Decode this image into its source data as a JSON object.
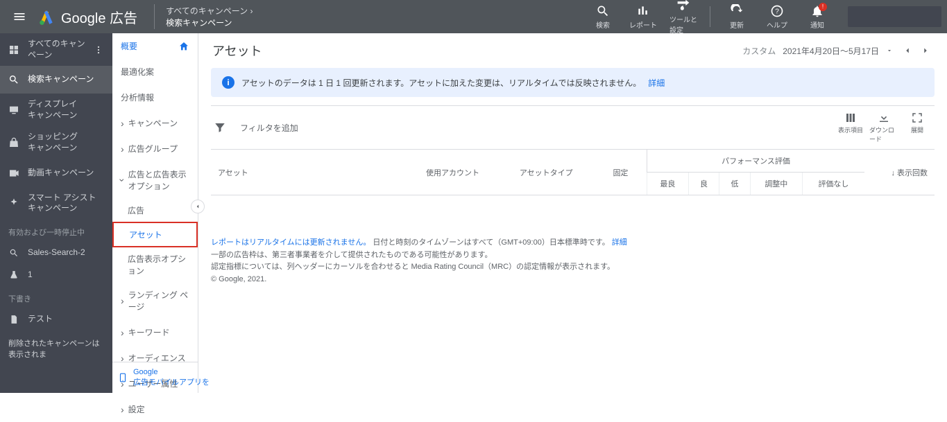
{
  "header": {
    "product": "Google 広告",
    "breadcrumb_top": "すべてのキャンペーン  ›",
    "breadcrumb_bot": "検索キャンペーン",
    "icons": {
      "search": "検索",
      "report": "レポート",
      "tools": "ツールと\n設定",
      "refresh": "更新",
      "help": "ヘルプ",
      "notif": "通知"
    }
  },
  "sidebar_dark": {
    "items": [
      {
        "label": "すべてのキャンペーン",
        "icon": "grid",
        "more": true
      },
      {
        "label": "検索キャンペーン",
        "icon": "search",
        "selected": true
      },
      {
        "label": "ディスプレイ\nキャンペーン",
        "icon": "display"
      },
      {
        "label": "ショッピング\nキャンペーン",
        "icon": "shopping"
      },
      {
        "label": "動画キャンペーン",
        "icon": "video"
      },
      {
        "label": "スマート アシスト\nキャンペーン",
        "icon": "smart"
      }
    ],
    "section1_hdr": "有効および一時停止中",
    "section1_items": [
      {
        "label": "Sales-Search-2",
        "icon": "search"
      },
      {
        "label": "1",
        "icon": "flask"
      }
    ],
    "section2_hdr": "下書き",
    "section2_items": [
      {
        "label": "テスト",
        "icon": "doc"
      }
    ],
    "deleted_note": "削除されたキャンペーンは表示されま"
  },
  "sidebar_light": {
    "overview": "概要",
    "recommend": "最適化案",
    "insights": "分析情報",
    "campaigns": "キャンペーン",
    "adgroups": "広告グループ",
    "ads_ext": "広告と広告表示オプション",
    "sub_ads": "広告",
    "sub_assets": "アセット",
    "sub_ext": "広告表示オプション",
    "landing": "ランディング ページ",
    "keywords": "キーワード",
    "audiences": "オーディエンス",
    "demographics": "ユーザー属性",
    "settings": "設定",
    "footer_app": "Google\n広告モバイルアプリを"
  },
  "main": {
    "title": "アセット",
    "date_custom": "カスタム",
    "date_range": "2021年4月20日～5月17日",
    "banner_text": "アセットのデータは 1 日 1 回更新されます。アセットに加えた変更は、リアルタイムでは反映されません。",
    "banner_link": "詳細",
    "filter_placeholder": "フィルタを追加",
    "tool_columns": "表示項目",
    "tool_download": "ダウンロード",
    "tool_expand": "展開",
    "table": {
      "asset": "アセット",
      "account": "使用アカウント",
      "type": "アセットタイプ",
      "pinned": "固定",
      "perf_group": "パフォーマンス評価",
      "perf_best": "最良",
      "perf_good": "良",
      "perf_low": "低",
      "perf_adjust": "調整中",
      "perf_none": "評価なし",
      "impressions": "表示回数"
    },
    "footer": {
      "l1a": "レポートはリアルタイムには更新されません。",
      "l1b": " 日付と時刻のタイムゾーンはすべて（GMT+09:00）日本標準時です。",
      "l1c": "詳細",
      "l2": "一部の広告枠は、第三者事業者を介して提供されたものである可能性があります。",
      "l3": "認定指標については、列ヘッダーにカーソルを合わせると Media Rating Council（MRC）の認定情報が表示されます。",
      "l4": "© Google, 2021."
    }
  }
}
